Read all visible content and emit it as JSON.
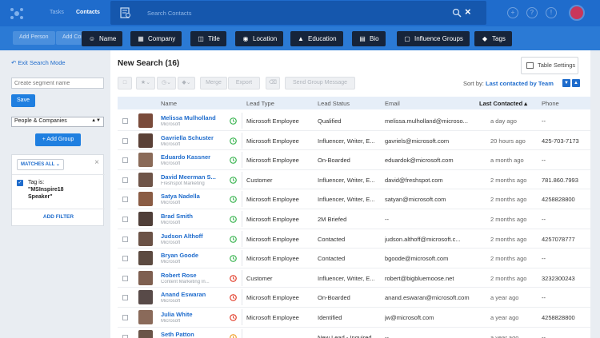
{
  "header": {
    "nav": [
      "Tasks",
      "Contacts"
    ],
    "search_placeholder": "Search Contacts",
    "close_symbol": "×"
  },
  "subbar": {
    "ghost_buttons": [
      "Add Person",
      "Add Company"
    ]
  },
  "filter_tabs": [
    {
      "label": "Name",
      "icon": "person-icon"
    },
    {
      "label": "Company",
      "icon": "building-icon"
    },
    {
      "label": "Title",
      "icon": "id-card-icon"
    },
    {
      "label": "Location",
      "icon": "map-pin-icon"
    },
    {
      "label": "Education",
      "icon": "graduation-cap-icon"
    },
    {
      "label": "Bio",
      "icon": "bio-card-icon"
    },
    {
      "label": "Influence Groups",
      "icon": "influence-group-icon"
    },
    {
      "label": "Tags",
      "icon": "tag-icon"
    }
  ],
  "sidebar": {
    "exit_label": "Exit Search Mode",
    "segment_placeholder": "Create segment name",
    "save_label": "Save",
    "scope_value": "People & Companies",
    "add_group_label": "+ Add Group",
    "matches_label": "MATCHES ALL",
    "tag_line1": "Tag is:",
    "tag_line2": "\"MSInspire18",
    "tag_line3": "Speaker\"",
    "add_filter_label": "ADD FILTER"
  },
  "main": {
    "title": "New Search (16)",
    "table_settings_label": "Table Settings",
    "toolbar": {
      "merge": "Merge",
      "export": "Export",
      "send": "Send Group Message"
    },
    "sort_label": "Sort by:",
    "sort_value": "Last contacted by Team",
    "columns": {
      "name": "Name",
      "lead_type": "Lead Type",
      "lead_status": "Lead Status",
      "email": "Email",
      "last_contacted": "Last Contacted",
      "phone": "Phone"
    }
  },
  "colors": {
    "brand_blue": "#1f6ccc",
    "clock_green": "#3db553",
    "clock_red": "#e2412e",
    "clock_orange": "#f0a12a"
  },
  "rows": [
    {
      "name": "Melissa Mulholland",
      "org": "Microsoft",
      "status_color": "#3db553",
      "lead_type": "Microsoft Employee",
      "lead_status": "Qualified",
      "email": "melissa.mulholland@microso...",
      "last": "a day ago",
      "phone": "--",
      "face": "#7a4b3a"
    },
    {
      "name": "Gavriella Schuster",
      "org": "Microsoft",
      "status_color": "#3db553",
      "lead_type": "Microsoft Employee",
      "lead_status": "Influencer, Writer, E...",
      "email": "gavriels@microsoft.com",
      "last": "20 hours ago",
      "phone": "425-703-7173",
      "face": "#5a4036"
    },
    {
      "name": "Eduardo Kassner",
      "org": "Microsoft",
      "status_color": "#3db553",
      "lead_type": "Microsoft Employee",
      "lead_status": "On-Boarded",
      "email": "eduardok@microsoft.com",
      "last": "a month ago",
      "phone": "--",
      "face": "#8a6a58"
    },
    {
      "name": "David Meerman S...",
      "org": "Freshspot Marketing",
      "status_color": "#3db553",
      "lead_type": "Customer",
      "lead_status": "Influencer, Writer, E...",
      "email": "david@freshspot.com",
      "last": "2 months ago",
      "phone": "781.860.7993",
      "face": "#6e5448"
    },
    {
      "name": "Satya Nadella",
      "org": "Microsoft",
      "status_color": "#3db553",
      "lead_type": "Microsoft Employee",
      "lead_status": "Influencer, Writer, E...",
      "email": "satyan@microsoft.com",
      "last": "2 months ago",
      "phone": "4258828800",
      "face": "#8a5c44"
    },
    {
      "name": "Brad Smith",
      "org": "Microsoft",
      "status_color": "#3db553",
      "lead_type": "Microsoft Employee",
      "lead_status": "2M Briefed",
      "email": "--",
      "last": "2 months ago",
      "phone": "--",
      "face": "#4f3e38"
    },
    {
      "name": "Judson Althoff",
      "org": "Microsoft",
      "status_color": "#3db553",
      "lead_type": "Microsoft Employee",
      "lead_status": "Contacted",
      "email": "judson.althoff@microsoft.c...",
      "last": "2 months ago",
      "phone": "4257078777",
      "face": "#6b5246"
    },
    {
      "name": "Bryan Goode",
      "org": "Microsoft",
      "status_color": "#3db553",
      "lead_type": "Microsoft Employee",
      "lead_status": "Contacted",
      "email": "bgoode@microsoft.com",
      "last": "2 months ago",
      "phone": "--",
      "face": "#5c4a40"
    },
    {
      "name": "Robert Rose",
      "org": "Content Marketing In...",
      "status_color": "#e2412e",
      "lead_type": "Customer",
      "lead_status": "Influencer, Writer, E...",
      "email": "robert@bigbluemoose.net",
      "last": "2 months ago",
      "phone": "3232300243",
      "face": "#7e5f50"
    },
    {
      "name": "Anand Eswaran",
      "org": "Microsoft",
      "status_color": "#e2412e",
      "lead_type": "Microsoft Employee",
      "lead_status": "On-Boarded",
      "email": "anand.eswaran@microsoft.com",
      "last": "a year ago",
      "phone": "--",
      "face": "#584a48"
    },
    {
      "name": "Julia White",
      "org": "Microsoft",
      "status_color": "#e2412e",
      "lead_type": "Microsoft Employee",
      "lead_status": "Identified",
      "email": "jw@microsoft.com",
      "last": "a year ago",
      "phone": "4258828800",
      "face": "#8a6a5a"
    },
    {
      "name": "Seth Patton",
      "org": "Microsoft",
      "status_color": "#f0a12a",
      "lead_type": "",
      "lead_status": "New Lead - Inquired",
      "email": "--",
      "last": "a year ago",
      "phone": "--",
      "face": "#6a5448"
    }
  ]
}
